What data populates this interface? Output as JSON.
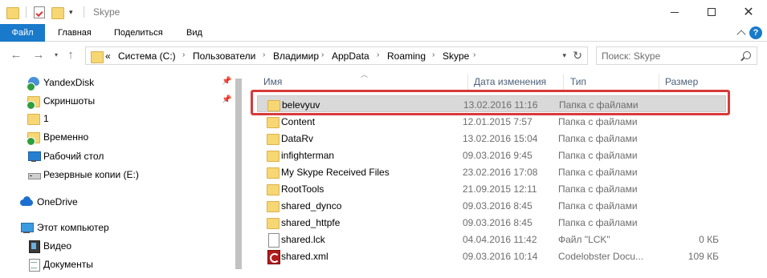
{
  "window": {
    "title": "Skype",
    "colors": {
      "accent": "#1979ca",
      "highlight": "#d83a3a",
      "folder": "#f7d674"
    }
  },
  "ribbon": {
    "tabs": [
      "Файл",
      "Главная",
      "Поделиться",
      "Вид"
    ],
    "help_label": "?"
  },
  "address": {
    "overflow": "«",
    "crumbs": [
      "Система (C:)",
      "Пользователи",
      "Владимир",
      "AppData",
      "Roaming",
      "Skype"
    ],
    "separator": "›"
  },
  "search": {
    "placeholder": "Поиск: Skype"
  },
  "sidebar": {
    "items": [
      {
        "label": "YandexDisk",
        "icon": "yandex-disk-icon",
        "pinned": true
      },
      {
        "label": "Скриншоты",
        "icon": "folder-synced-icon",
        "pinned": true
      },
      {
        "label": "1",
        "icon": "folder-icon",
        "pinned": false
      },
      {
        "label": "Временно",
        "icon": "folder-synced-icon",
        "pinned": false
      },
      {
        "label": "Рабочий стол",
        "icon": "desktop-icon",
        "pinned": false
      },
      {
        "label": "Резервные копии (E:)",
        "icon": "drive-icon",
        "pinned": false
      },
      {
        "label": "OneDrive",
        "icon": "onedrive-icon",
        "pinned": false
      },
      {
        "label": "Этот компьютер",
        "icon": "computer-icon",
        "pinned": false
      },
      {
        "label": "Видео",
        "icon": "video-icon",
        "pinned": false
      },
      {
        "label": "Документы",
        "icon": "documents-icon",
        "pinned": false
      }
    ]
  },
  "files": {
    "columns": {
      "name": "Имя",
      "date": "Дата изменения",
      "type": "Тип",
      "size": "Размер"
    },
    "rows": [
      {
        "name": "belevyuv",
        "date": "13.02.2016 11:16",
        "type": "Папка с файлами",
        "size": "",
        "icon": "folder-icon",
        "selected": true
      },
      {
        "name": "Content",
        "date": "12.01.2015 7:57",
        "type": "Папка с файлами",
        "size": "",
        "icon": "folder-icon"
      },
      {
        "name": "DataRv",
        "date": "13.02.2016 15:04",
        "type": "Папка с файлами",
        "size": "",
        "icon": "folder-icon"
      },
      {
        "name": "infighterman",
        "date": "09.03.2016 9:45",
        "type": "Папка с файлами",
        "size": "",
        "icon": "folder-icon"
      },
      {
        "name": "My Skype Received Files",
        "date": "23.02.2016 17:08",
        "type": "Папка с файлами",
        "size": "",
        "icon": "folder-icon"
      },
      {
        "name": "RootTools",
        "date": "21.09.2015 12:11",
        "type": "Папка с файлами",
        "size": "",
        "icon": "folder-icon"
      },
      {
        "name": "shared_dynco",
        "date": "09.03.2016 8:45",
        "type": "Папка с файлами",
        "size": "",
        "icon": "folder-icon"
      },
      {
        "name": "shared_httpfe",
        "date": "09.03.2016 8:45",
        "type": "Папка с файлами",
        "size": "",
        "icon": "folder-icon"
      },
      {
        "name": "shared.lck",
        "date": "04.04.2016 11:42",
        "type": "Файл \"LCK\"",
        "size": "0 КБ",
        "icon": "file-icon"
      },
      {
        "name": "shared.xml",
        "date": "09.03.2016 10:14",
        "type": "Codelobster Docu...",
        "size": "109 КБ",
        "icon": "xml-file-icon"
      }
    ]
  }
}
